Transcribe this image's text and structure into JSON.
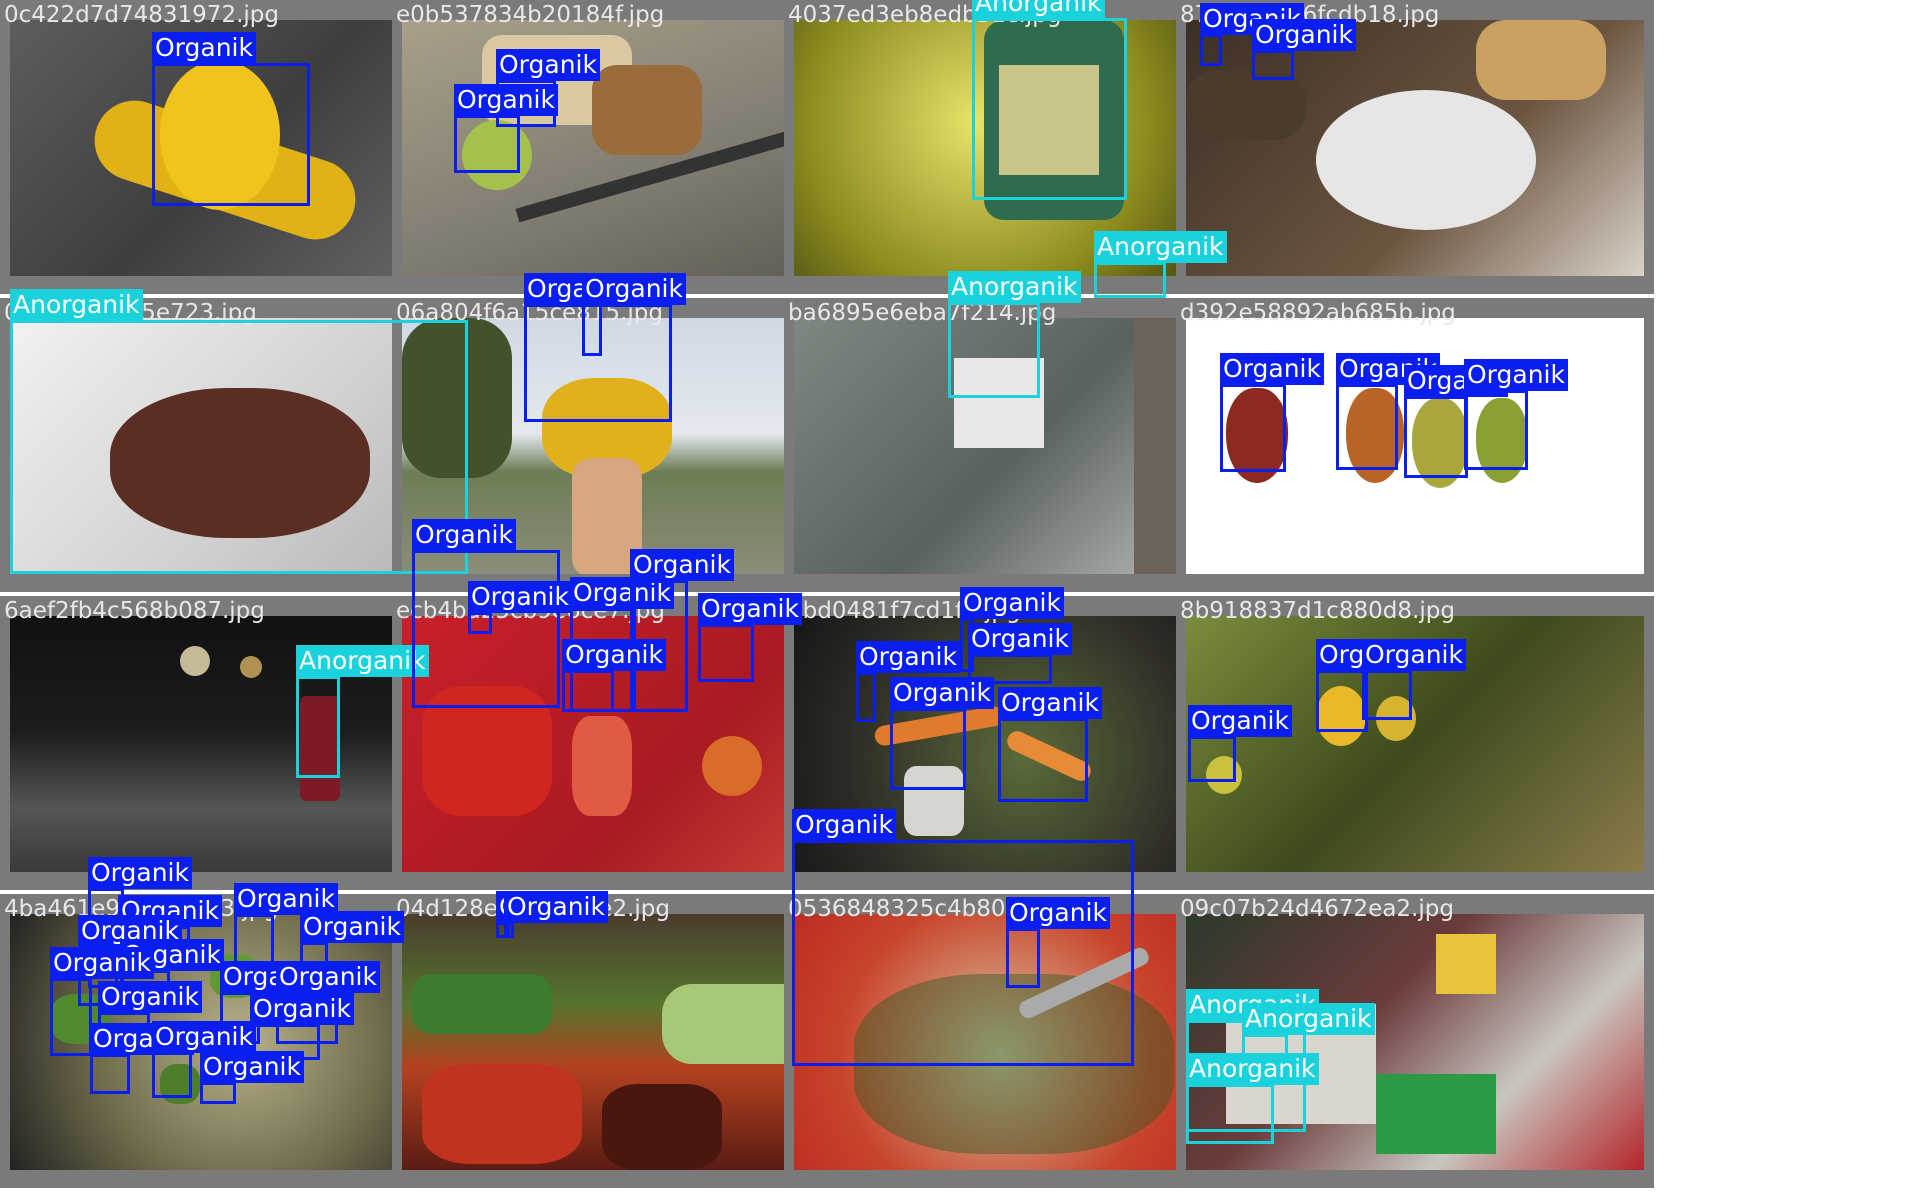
{
  "colors": {
    "organik": "#0a1ef0",
    "anorganik": "#19d2dc",
    "tile_border": "#7a7a7a",
    "filename_text": "#e8e8e8"
  },
  "labels": {
    "organik": "Organik",
    "anorganik": "Anorganik"
  },
  "tiles": [
    {
      "filename": "0c422d7d74831972.jpg"
    },
    {
      "filename": "e0b537834b20184f.jpg"
    },
    {
      "filename": "4037ed3eb8edb31c.jpg"
    },
    {
      "filename": "87f3d9ec86fcdb18.jpg"
    },
    {
      "filename": "0c9b5f2e055e723.jpg"
    },
    {
      "filename": "06a804f6a15ce815.jpg"
    },
    {
      "filename": "ba6895e6eba7f214.jpg"
    },
    {
      "filename": "d392e58892ab685b.jpg"
    },
    {
      "filename": "6aef2fb4c568b087.jpg"
    },
    {
      "filename": "ecb4ba25cb9e6ce7.jpg"
    },
    {
      "filename": "2bd0481f7cd1f1.jpg"
    },
    {
      "filename": "8b918837d1c880d8.jpg"
    },
    {
      "filename": "4ba461e9c3d9b673.jpg"
    },
    {
      "filename": "04d128e1b8c9d5e2.jpg"
    },
    {
      "filename": "0536848325c4b80c.jpg"
    },
    {
      "filename": "09c07b24d4672ea2.jpg"
    }
  ]
}
